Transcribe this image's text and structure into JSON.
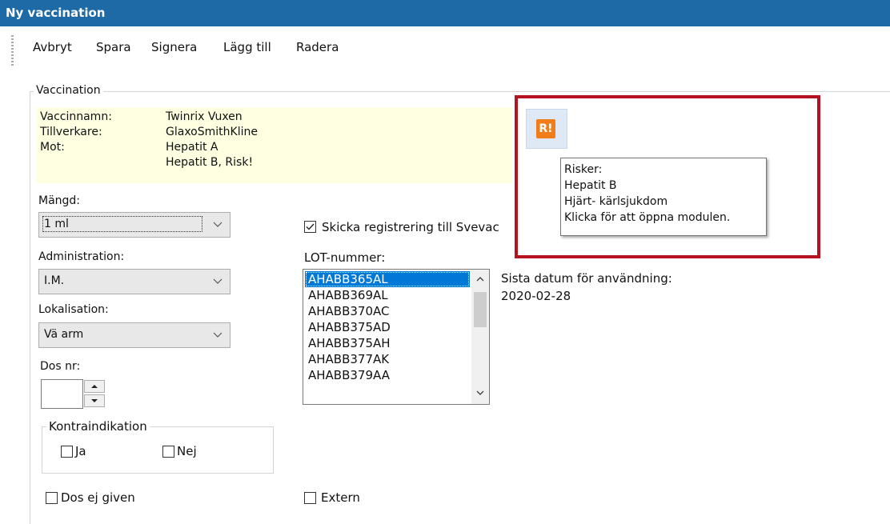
{
  "window": {
    "title": "Ny vaccination"
  },
  "menu": {
    "items": [
      "Avbryt",
      "Spara",
      "Signera",
      "Lägg till",
      "Radera"
    ]
  },
  "vaccination": {
    "group_label": "Vaccination",
    "info": {
      "name_label": "Vaccinnamn:",
      "name_value": "Twinrix Vuxen",
      "maker_label": "Tillverkare:",
      "maker_value": "GlaxoSmithKline",
      "against_label": "Mot:",
      "against_values": [
        "Hepatit A",
        "Hepatit B, Risk!"
      ]
    },
    "amount": {
      "label": "Mängd:",
      "value": "1 ml"
    },
    "administration": {
      "label": "Administration:",
      "value": "I.M."
    },
    "localisation": {
      "label": "Lokalisation:",
      "value": "Vä arm"
    },
    "dose": {
      "label": "Dos nr:",
      "value": ""
    },
    "contraindication": {
      "label": "Kontraindikation",
      "yes": "Ja",
      "no": "Nej"
    },
    "dose_not_given": "Dos ej given",
    "send_registration": {
      "label": "Skicka registrering till Svevac",
      "checked": true
    },
    "lot": {
      "label": "LOT-nummer:",
      "items": [
        "AHABB365AL",
        "AHABB369AL",
        "AHABB370AC",
        "AHABB375AD",
        "AHABB375AH",
        "AHABB377AK",
        "AHABB379AA"
      ],
      "selected": "AHABB365AL"
    },
    "last_date": {
      "label": "Sista datum för användning:",
      "value": "2020-02-28"
    },
    "extern": "Extern"
  },
  "risk": {
    "logo_text": "R!",
    "tooltip": [
      "Risker:",
      "Hepatit B",
      "Hjärt- kärlsjukdom",
      "Klicka för att öppna modulen."
    ],
    "highlight_color": "#b4121e",
    "logo_color": "#f07d1a"
  }
}
